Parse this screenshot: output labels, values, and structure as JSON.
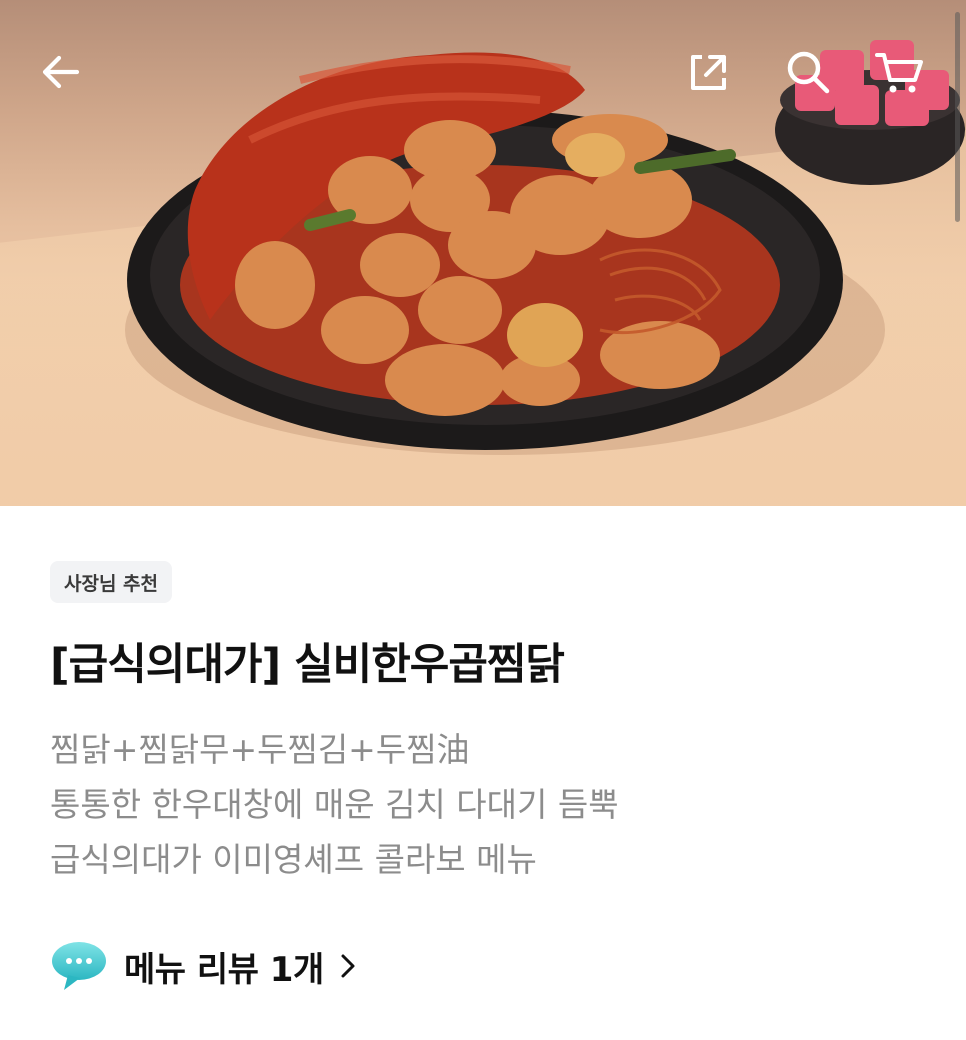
{
  "header": {
    "back_icon": "arrow-left-icon",
    "share_icon": "share-external-icon",
    "search_icon": "search-icon",
    "cart_icon": "cart-icon"
  },
  "hero": {
    "image_description_icon": "food-photo"
  },
  "product": {
    "badge": "사장님 추천",
    "title": "[급식의대가] 실비한우곱찜닭",
    "description_lines": [
      "찜닭+찜닭무+두찜김+두찜油",
      "통통한 한우대창에 매운 김치 다대기 듬뿍",
      "급식의대가 이미영셰프 콜라보 메뉴"
    ]
  },
  "review": {
    "icon": "speech-bubble-icon",
    "label": "메뉴 리뷰 1개",
    "chevron": "chevron-right-icon"
  },
  "colors": {
    "title": "#111111",
    "description": "#8c8c8c",
    "badge_bg": "#f2f3f5",
    "bubble": "#3fc9d0"
  }
}
